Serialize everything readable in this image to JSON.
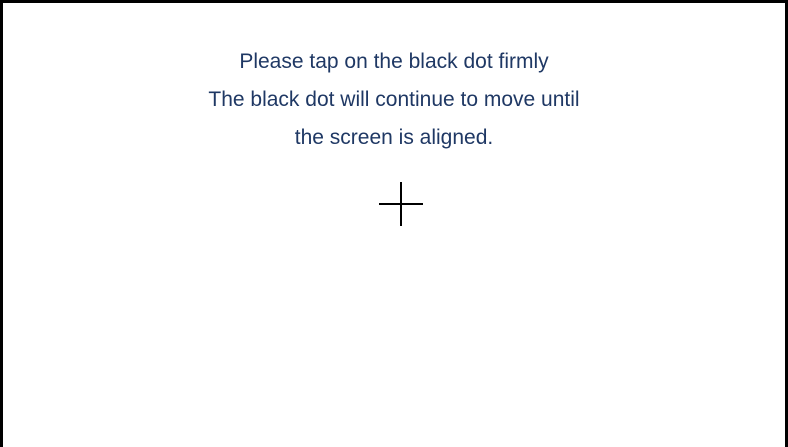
{
  "calibration": {
    "instructions": [
      "Please tap on the black dot firmly",
      "The black dot will continue to move until",
      "the screen is aligned."
    ],
    "target_icon": "crosshair-icon",
    "colors": {
      "text": "#1f3864",
      "target": "#000000",
      "background": "#ffffff"
    }
  }
}
